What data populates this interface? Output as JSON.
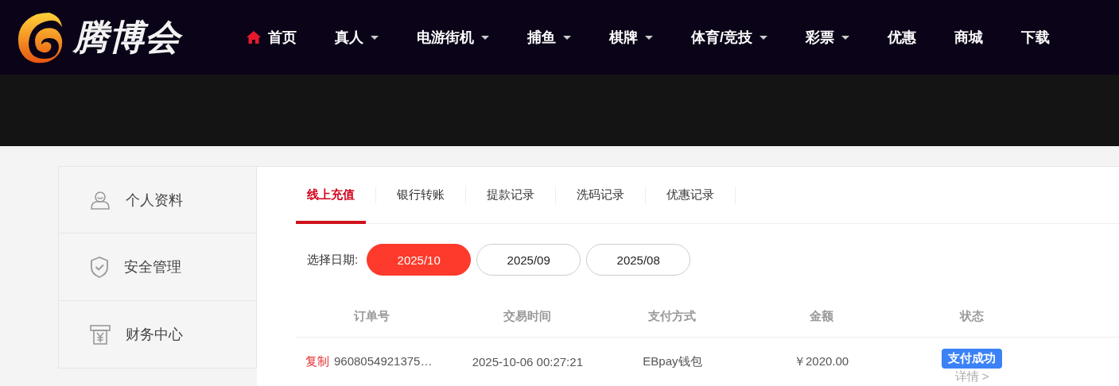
{
  "header": {
    "logo_text": "腾博会",
    "nav": [
      {
        "label": "首页",
        "kind": "home",
        "dropdown": false
      },
      {
        "label": "真人",
        "kind": "plain",
        "dropdown": true
      },
      {
        "label": "电游街机",
        "kind": "plain",
        "dropdown": true
      },
      {
        "label": "捕鱼",
        "kind": "plain",
        "dropdown": true
      },
      {
        "label": "棋牌",
        "kind": "plain",
        "dropdown": true
      },
      {
        "label": "体育/竞技",
        "kind": "plain",
        "dropdown": true
      },
      {
        "label": "彩票",
        "kind": "plain",
        "dropdown": true
      },
      {
        "label": "优惠",
        "kind": "plain",
        "dropdown": false
      },
      {
        "label": "商城",
        "kind": "plain",
        "dropdown": false
      },
      {
        "label": "下载",
        "kind": "plain",
        "dropdown": false
      }
    ]
  },
  "sidebar": {
    "items": [
      {
        "label": "个人资料",
        "kind": "profile"
      },
      {
        "label": "安全管理",
        "kind": "security"
      },
      {
        "label": "财务中心",
        "kind": "finance"
      }
    ]
  },
  "tabs": [
    {
      "label": "线上充值",
      "selected": true
    },
    {
      "label": "银行转账",
      "selected": false
    },
    {
      "label": "提款记录",
      "selected": false
    },
    {
      "label": "洗码记录",
      "selected": false
    },
    {
      "label": "优惠记录",
      "selected": false
    }
  ],
  "date_filter": {
    "label": "选择日期:",
    "options": [
      {
        "label": "2025/10",
        "selected": true
      },
      {
        "label": "2025/09",
        "selected": false
      },
      {
        "label": "2025/08",
        "selected": false
      }
    ]
  },
  "table": {
    "columns": [
      "订单号",
      "交易时间",
      "支付方式",
      "金额",
      "状态"
    ],
    "rows": [
      {
        "copy": "复制",
        "order": "9608054921375…",
        "time": "2025-10-06 00:27:21",
        "method": "EBpay钱包",
        "amount": "￥2020.00",
        "status": "支付成功",
        "detail": "详情 >"
      }
    ]
  }
}
